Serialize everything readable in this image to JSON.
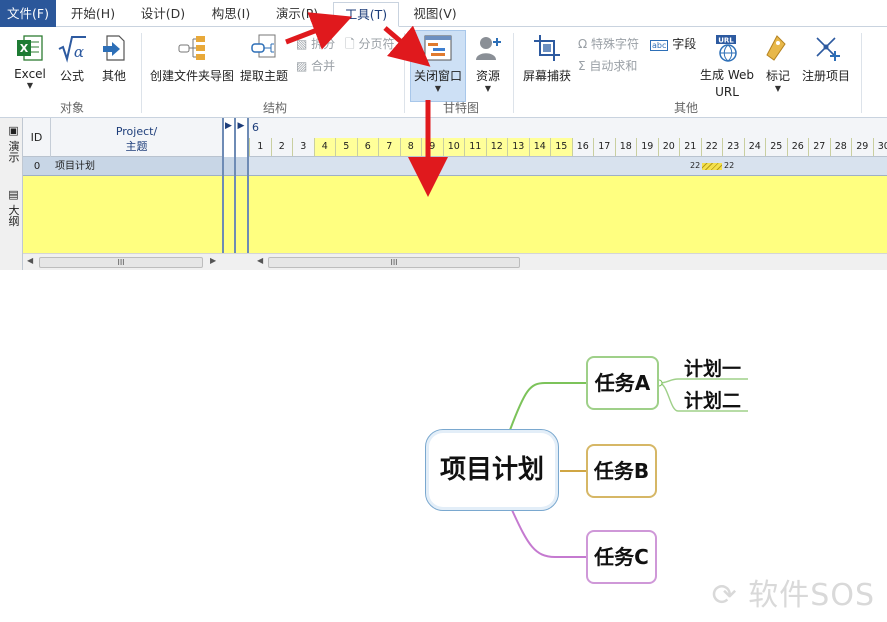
{
  "menu": {
    "tabs": [
      {
        "label": "文件(F)"
      },
      {
        "label": "开始(H)"
      },
      {
        "label": "设计(D)"
      },
      {
        "label": "构思(I)"
      },
      {
        "label": "演示(P)"
      },
      {
        "label": "工具(T)"
      },
      {
        "label": "视图(V)"
      }
    ],
    "active_tab": "工具(T)"
  },
  "ribbon": {
    "groups": {
      "objects": {
        "label": "对象",
        "excel": "Excel",
        "formula": "公式",
        "other": "其他"
      },
      "structure": {
        "label": "结构",
        "create_folder_map": "创建文件夹导图",
        "extract_topic": "提取主题",
        "split": "拆分",
        "merge": "合并",
        "page_break": "分页符"
      },
      "gantt": {
        "label": "甘特图",
        "close_window": "关闭窗口",
        "resources": "资源"
      },
      "other": {
        "label": "其他",
        "screen_capture": "屏幕捕获",
        "special_char": "特殊字符",
        "auto_sum": "自动求和",
        "field": "字段",
        "field_badge": "abc",
        "gen_web_url": "生成 Web URL",
        "gen_web_url_line1": "生成 Web",
        "gen_web_url_line2": "URL",
        "url_badge": "URL",
        "mark": "标记",
        "register_project": "注册项目"
      }
    }
  },
  "sidebar_tabs": {
    "present": "演示",
    "outline": "大纲"
  },
  "gantt": {
    "col_id": "ID",
    "col_project_line1": "Project/",
    "col_project_line2": "主题",
    "month": "6",
    "days": [
      "1",
      "2",
      "3",
      "4",
      "5",
      "6",
      "7",
      "8",
      "9",
      "10",
      "11",
      "12",
      "13",
      "14",
      "15",
      "16",
      "17",
      "18",
      "19",
      "20",
      "21",
      "22",
      "23",
      "24",
      "25",
      "26",
      "27",
      "28",
      "29",
      "30"
    ],
    "highlight_days": [
      "4",
      "5",
      "6",
      "7",
      "8",
      "9",
      "10",
      "11",
      "12",
      "13",
      "14",
      "15"
    ],
    "rows": [
      {
        "id": "0",
        "name": "项目计划",
        "bar_start": "22",
        "bar_end": "22"
      }
    ],
    "scroll_thumb": "III"
  },
  "mindmap": {
    "central": "项目计划",
    "branches": [
      {
        "label": "任务A",
        "color": "#7cc35a",
        "children": [
          "计划一",
          "计划二"
        ]
      },
      {
        "label": "任务B",
        "color": "#d0a644"
      },
      {
        "label": "任务C",
        "color": "#c57ad0"
      }
    ]
  },
  "watermark": "软件SOS",
  "colors": {
    "file_tab": "#2b579a",
    "selected_tool": "#cde0f5",
    "gantt_yellow": "#ffff80",
    "row_blue": "#c8d6e6",
    "annotation_arrow": "#e0191d"
  }
}
